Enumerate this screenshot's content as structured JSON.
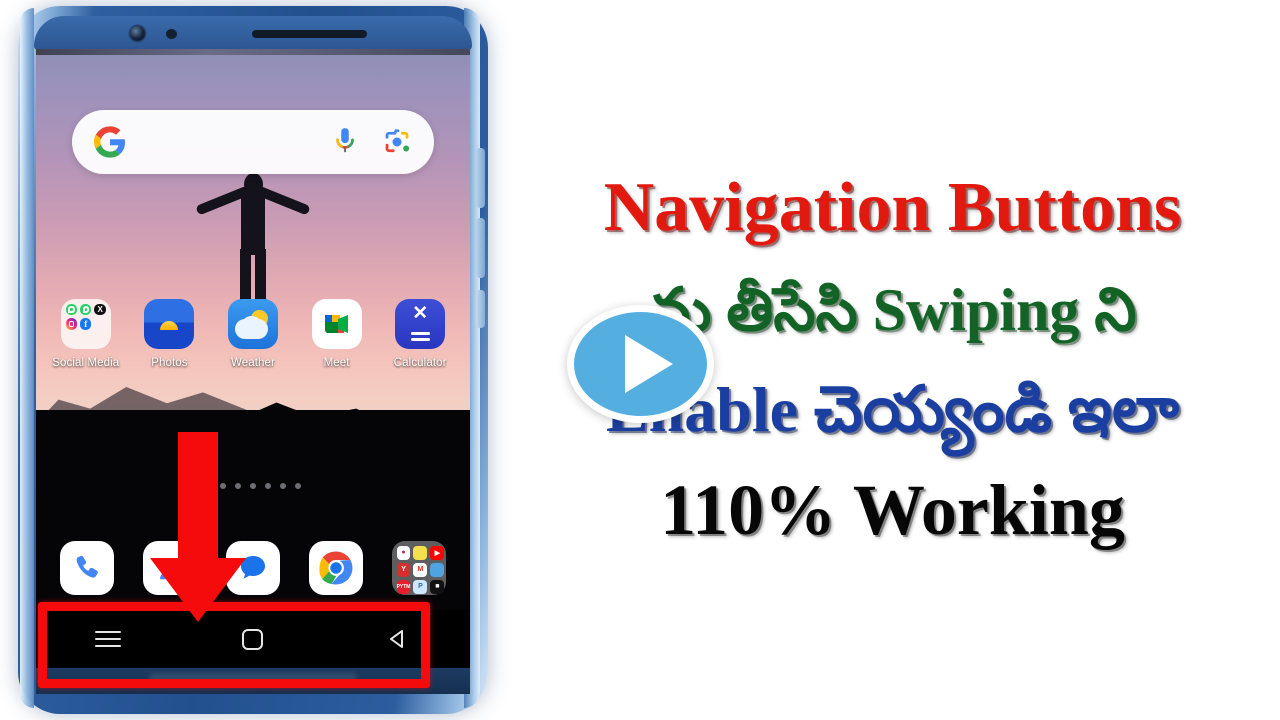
{
  "thumbnail": {
    "headline_lines": [
      {
        "text": "Navigation Buttons",
        "color": "#E2190F",
        "language": "en"
      },
      {
        "text": "ను తీసేసి Swiping  ని",
        "color": "#136326",
        "language": "te"
      },
      {
        "text": "Enable చెయ్యండి ఇలా",
        "color": "#1A3FA0",
        "language": "te"
      },
      {
        "text": "110% Working",
        "color": "#070707",
        "language": "en"
      }
    ],
    "play_button": {
      "name": "play-button",
      "fill": "#55AEE0",
      "ring": "#FFFFFF"
    },
    "highlight": {
      "name": "navigation-bar-highlight",
      "color": "#F50B0B"
    },
    "arrow": {
      "name": "pointer-arrow",
      "color": "#F50B0B",
      "direction": "down"
    },
    "background": "#FFFFFF"
  },
  "phone": {
    "frame_color": "#2C5692",
    "status_bar": {
      "camera": "front-camera",
      "sensor": "proximity-sensor",
      "speaker": "earpiece-speaker"
    },
    "search_bar": {
      "placeholder": "",
      "value": "",
      "logo": "google-g-logo",
      "mic": "microphone-icon",
      "lens": "google-lens-icon"
    },
    "apps": [
      {
        "label": "Social Media",
        "icon": "social-media-folder",
        "folder_items": [
          "WhatsApp",
          "WhatsApp Business",
          "X",
          "Instagram",
          "Facebook"
        ]
      },
      {
        "label": "Photos",
        "icon": "google-photos-icon"
      },
      {
        "label": "Weather",
        "icon": "weather-icon"
      },
      {
        "label": "Meet",
        "icon": "google-meet-icon"
      },
      {
        "label": "Calculator",
        "icon": "calculator-icon"
      }
    ],
    "page_indicator": {
      "total": 7,
      "active": 1
    },
    "dock": [
      {
        "label": "Phone",
        "icon": "phone-icon"
      },
      {
        "label": "Contacts",
        "icon": "contacts-icon"
      },
      {
        "label": "Messages",
        "icon": "messages-icon"
      },
      {
        "label": "Chrome",
        "icon": "chrome-icon"
      },
      {
        "label": "Apps",
        "icon": "apps-folder-icon"
      }
    ],
    "navigation_bar": {
      "style": "3-button",
      "buttons": [
        {
          "label": "Recents",
          "icon": "recents-icon"
        },
        {
          "label": "Home",
          "icon": "home-icon"
        },
        {
          "label": "Back",
          "icon": "back-icon"
        }
      ]
    }
  }
}
